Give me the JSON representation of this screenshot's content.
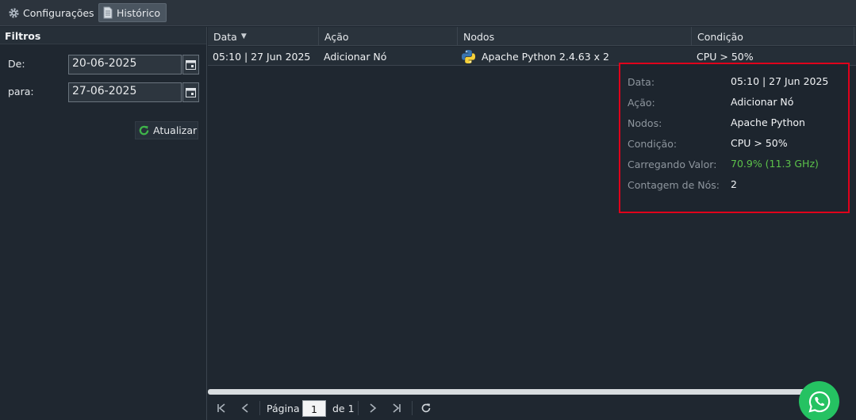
{
  "tabs": [
    {
      "label": "Configurações",
      "icon": "gear-icon"
    },
    {
      "label": "Histórico",
      "icon": "document-icon"
    }
  ],
  "filters": {
    "title": "Filtros",
    "from_label": "De:",
    "from_value": "20-06-2025",
    "to_label": "para:",
    "to_value": "27-06-2025",
    "refresh_label": "Atualizar"
  },
  "grid": {
    "columns": [
      "Data",
      "Ação",
      "Nodos",
      "Condição"
    ],
    "sort_column": "Data",
    "sort_direction": "desc",
    "rows": [
      {
        "data": "05:10 | 27 Jun 2025",
        "acao": "Adicionar Nó",
        "nodos": "Apache Python 2.4.63 x 2",
        "nodos_icon": "python-icon",
        "condicao": "CPU > 50%"
      }
    ]
  },
  "tooltip": {
    "items": [
      {
        "label": "Data:",
        "value": "05:10 | 27 Jun 2025"
      },
      {
        "label": "Ação:",
        "value": "Adicionar Nó"
      },
      {
        "label": "Nodos:",
        "value": "Apache Python"
      },
      {
        "label": "Condição:",
        "value": "CPU > 50%"
      },
      {
        "label": "Carregando Valor:",
        "value": "70.9% (11.3 GHz)"
      },
      {
        "label": "Contagem de Nós:",
        "value": "2"
      }
    ],
    "highlight_color": "#e0001b",
    "value_green": "#5cc24a"
  },
  "pager": {
    "page_label": "Página",
    "page_value": "1",
    "of_label": "de 1"
  },
  "colors": {
    "background": "#1f2730",
    "header": "#2a333c",
    "whatsapp": "#25c262"
  }
}
